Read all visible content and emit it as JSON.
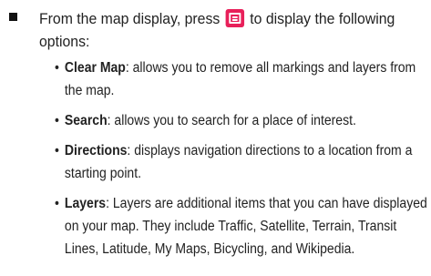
{
  "intro": {
    "before_icon": "From the map display, press",
    "after_icon": "to display the following options:",
    "icon": "menu-key-icon",
    "icon_color": "#e8205a"
  },
  "options": [
    {
      "title": "Clear Map",
      "description": ": allows you to remove all markings and layers from the map."
    },
    {
      "title": "Search",
      "description": ": allows you to search for a place of interest."
    },
    {
      "title": "Directions",
      "description": ": displays navigation directions to a location from a starting point."
    },
    {
      "title": "Layers",
      "description": ": Layers are additional items that you can have displayed on your map. They include Traffic, Satellite, Terrain, Transit Lines, Latitude, My Maps, Bicycling, and Wikipedia."
    }
  ]
}
